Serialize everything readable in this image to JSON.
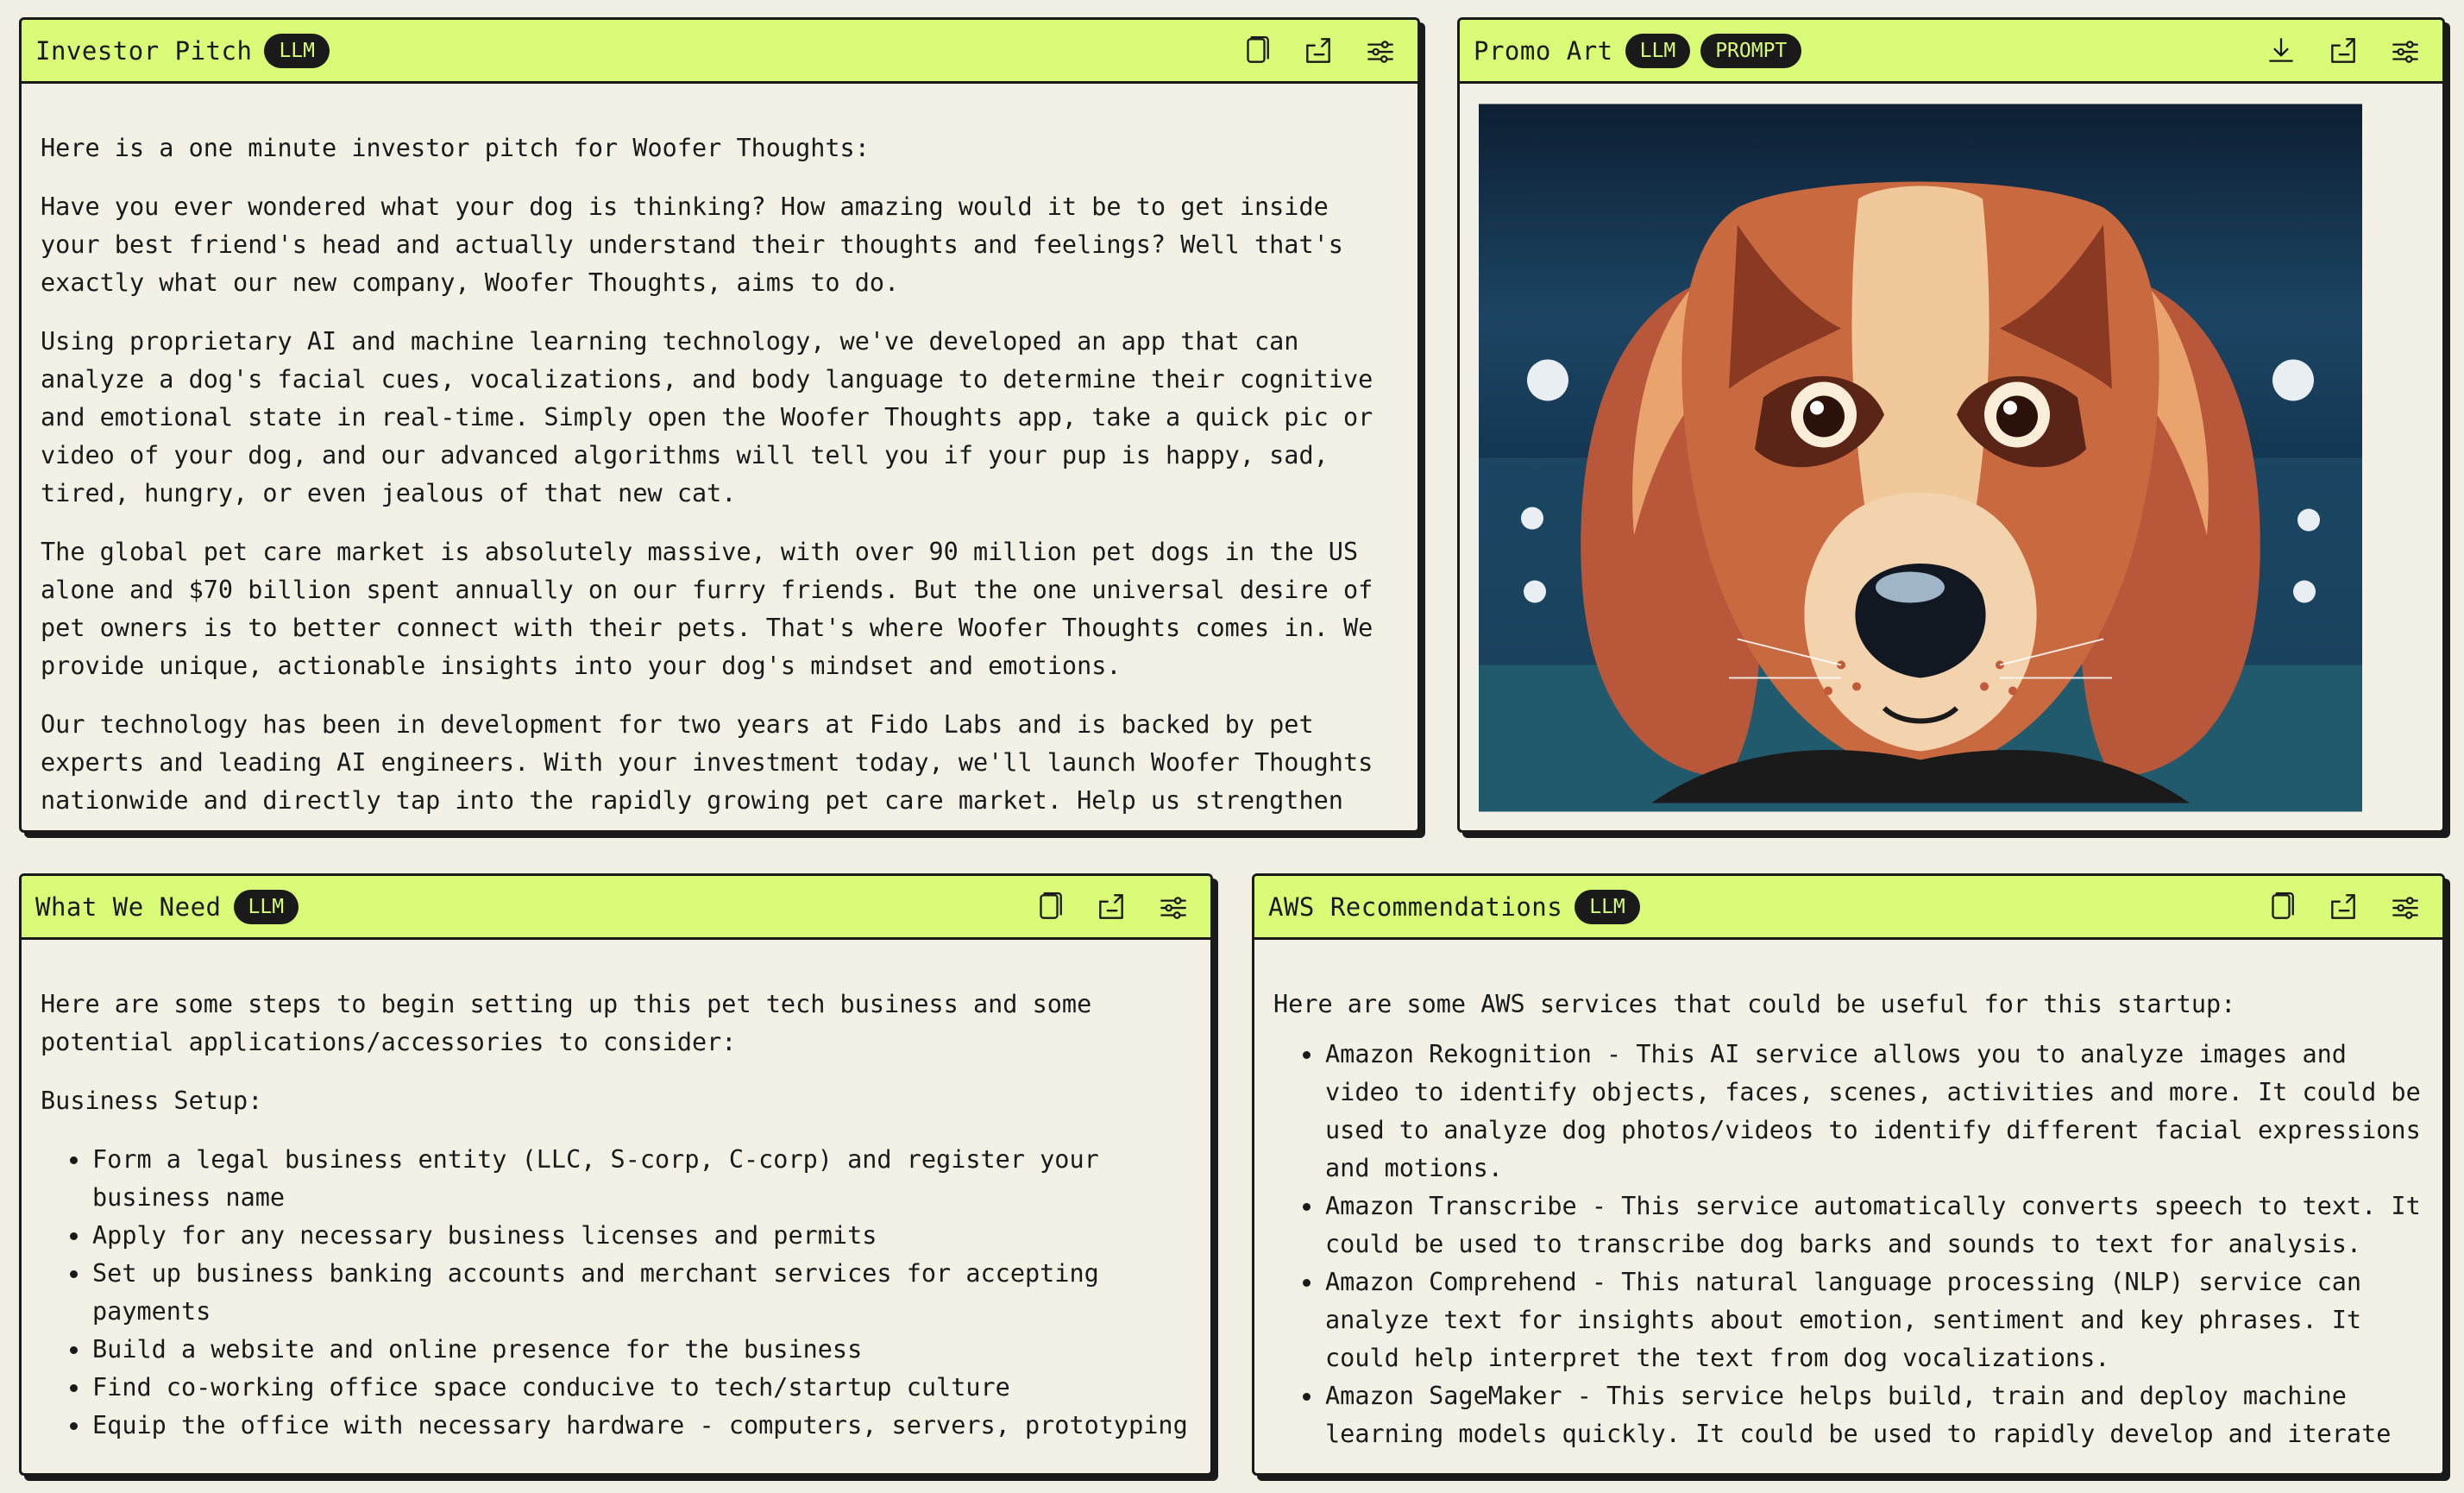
{
  "panels": {
    "pitch": {
      "title": "Investor Pitch",
      "badges": [
        "LLM"
      ],
      "icons": [
        "copy-icon",
        "share-icon",
        "settings-icon"
      ],
      "paragraphs": [
        "Here is a one minute investor pitch for Woofer Thoughts:",
        "Have you ever wondered what your dog is thinking? How amazing would it be to get inside your best friend's head and actually understand their thoughts and feelings? Well that's exactly what our new company, Woofer Thoughts, aims to do.",
        "Using proprietary AI and machine learning technology, we've developed an app that can analyze a dog's facial cues, vocalizations, and body language to determine their cognitive and emotional state in real-time. Simply open the Woofer Thoughts app, take a quick pic or video of your dog, and our advanced algorithms will tell you if your pup is happy, sad, tired, hungry, or even jealous of that new cat.",
        "The global pet care market is absolutely massive, with over 90 million pet dogs in the US alone and $70 billion spent annually on our furry friends. But the one universal desire of pet owners is to better connect with their pets. That's where Woofer Thoughts comes in. We provide unique, actionable insights into your dog's mindset and emotions.",
        "Our technology has been in development for two years at Fido Labs and is backed by pet experts and leading AI engineers. With your investment today, we'll launch Woofer Thoughts nationwide and directly tap into the rapidly growing pet care market. Help us strengthen the"
      ]
    },
    "art": {
      "title": "Promo Art",
      "badges": [
        "LLM",
        "PROMPT"
      ],
      "icons": [
        "download-icon",
        "share-icon",
        "settings-icon"
      ],
      "image_subject": "dog-portrait-illustration"
    },
    "need": {
      "title": "What We Need",
      "badges": [
        "LLM"
      ],
      "icons": [
        "copy-icon",
        "share-icon",
        "settings-icon"
      ],
      "intro": "Here are some steps to begin setting up this pet tech business and some potential applications/accessories to consider:",
      "section": "Business Setup:",
      "items": [
        "Form a legal business entity (LLC, S-corp, C-corp) and register your business name",
        "Apply for any necessary business licenses and permits",
        "Set up business banking accounts and merchant services for accepting payments",
        "Build a website and online presence for the business",
        "Find co-working office space conducive to tech/startup culture",
        "Equip the office with necessary hardware - computers, servers, prototyping"
      ]
    },
    "aws": {
      "title": "AWS Recommendations",
      "badges": [
        "LLM"
      ],
      "icons": [
        "copy-icon",
        "share-icon",
        "settings-icon"
      ],
      "intro": "Here are some AWS services that could be useful for this startup:",
      "items": [
        "Amazon Rekognition - This AI service allows you to analyze images and video to identify objects, faces, scenes, activities and more. It could be used to analyze dog photos/videos to identify different facial expressions and motions.",
        "Amazon Transcribe - This service automatically converts speech to text. It could be used to transcribe dog barks and sounds to text for analysis.",
        "Amazon Comprehend - This natural language processing (NLP) service can analyze text for insights about emotion, sentiment and key phrases. It could help interpret the text from dog vocalizations.",
        "Amazon SageMaker - This service helps build, train and deploy machine learning models quickly. It could be used to rapidly develop and iterate"
      ]
    }
  },
  "colors": {
    "header_bg": "#d9fb77",
    "panel_bg": "#f3f1e6",
    "page_bg": "#f1efe4",
    "ink": "#1a1a1a"
  }
}
